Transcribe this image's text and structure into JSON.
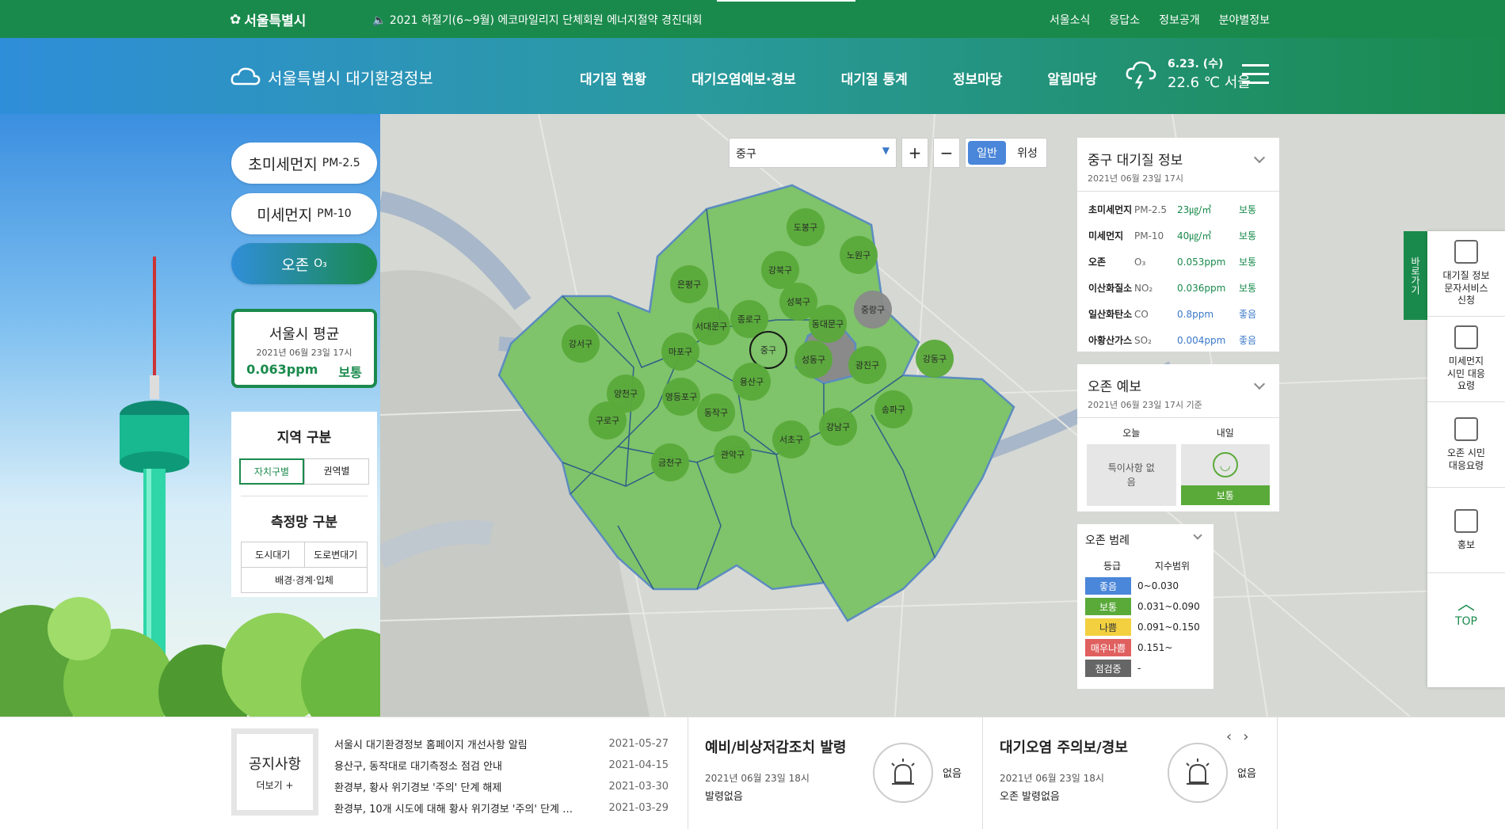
{
  "topbar": {
    "logo": "서울특별시",
    "notice": "2021 하절기(6~9월) 에코마일리지 단체회원 에너지절약 경진대회",
    "links": [
      "서울소식",
      "응답소",
      "정보공개",
      "분야별정보"
    ]
  },
  "header": {
    "site_title": "서울특별시 대기환경정보",
    "menu": [
      "대기질 현황",
      "대기오염예보·경보",
      "대기질 통계",
      "정보마당",
      "알림마당"
    ],
    "weather_date": "6.23. (수)",
    "weather_temp": "22.6 ℃ 서울"
  },
  "pollutant_tabs": [
    {
      "label": "초미세먼지",
      "sub": "PM-2.5"
    },
    {
      "label": "미세먼지",
      "sub": "PM-10"
    },
    {
      "label": "오존",
      "sub": "O₃"
    }
  ],
  "average": {
    "title": "서울시 평균",
    "date": "2021년 06월 23일 17시",
    "value": "0.063ppm",
    "status": "보통"
  },
  "region": {
    "title": "지역 구분",
    "buttons": [
      "자치구별",
      "권역별"
    ],
    "network_title": "측정망 구분",
    "network": [
      "도시대기",
      "도로변대기",
      "배경·경계·입체"
    ]
  },
  "map_tools": {
    "district": "중구",
    "plus": "+",
    "minus": "−",
    "mode_normal": "일반",
    "mode_satellite": "위성"
  },
  "districts": [
    "도봉구",
    "노원구",
    "강북구",
    "은평구",
    "성북구",
    "중랑구",
    "종로구",
    "서대문구",
    "동대문구",
    "강서구",
    "마포구",
    "중구",
    "성동구",
    "광진구",
    "강동구",
    "용산구",
    "양천구",
    "영등포구",
    "동작구",
    "송파구",
    "구로구",
    "강남구",
    "서초구",
    "관악구",
    "금천구"
  ],
  "info_panel": {
    "title": "중구 대기질 정보",
    "date": "2021년 06월 23일 17시",
    "rows": [
      {
        "name": "초미세먼지",
        "code": "PM-2.5",
        "value": "23㎍/㎥",
        "status": "보통"
      },
      {
        "name": "미세먼지",
        "code": "PM-10",
        "value": "40㎍/㎥",
        "status": "보통"
      },
      {
        "name": "오존",
        "code": "O₃",
        "value": "0.053ppm",
        "status": "보통"
      },
      {
        "name": "이산화질소",
        "code": "NO₂",
        "value": "0.036ppm",
        "status": "보통"
      },
      {
        "name": "일산화탄소",
        "code": "CO",
        "value": "0.8ppm",
        "status": "좋음"
      },
      {
        "name": "아황산가스",
        "code": "SO₂",
        "value": "0.004ppm",
        "status": "좋음"
      }
    ]
  },
  "ozone_forecast": {
    "title": "오존 예보",
    "date": "2021년 06월 23일 17시 기준",
    "today_label": "오늘",
    "today_text": "특이사항 없음",
    "tomorrow_label": "내일",
    "tomorrow_status": "보통"
  },
  "legend": {
    "title": "오존 범례",
    "col1": "등급",
    "col2": "지수범위",
    "rows": [
      {
        "grade": "좋음",
        "range": "0~0.030",
        "color": "#4a86d9"
      },
      {
        "grade": "보통",
        "range": "0.031~0.090",
        "color": "#5aaa3a"
      },
      {
        "grade": "나쁨",
        "range": "0.091~0.150",
        "color": "#f2d040"
      },
      {
        "grade": "매우나쁨",
        "range": "0.151~",
        "color": "#e06060"
      },
      {
        "grade": "점검중",
        "range": "-",
        "color": "#666666"
      }
    ]
  },
  "quick_link": "바로가기",
  "sidebar": [
    {
      "label": "대기질 정보 문자서비스 신청"
    },
    {
      "label": "미세먼지 시민 대응요령"
    },
    {
      "label": "오존 시민 대응요령"
    },
    {
      "label": "홍보"
    }
  ],
  "top_label": "TOP",
  "notice_box": {
    "title": "공지사항",
    "more": "더보기 +"
  },
  "notices": [
    {
      "title": "서울시 대기환경정보 홈페이지 개선사항 알림",
      "date": "2021-05-27"
    },
    {
      "title": "용산구, 동작대로 대기측정소 점검 안내",
      "date": "2021-04-15"
    },
    {
      "title": "환경부, 황사 위기경보 '주의' 단계 해제",
      "date": "2021-03-30"
    },
    {
      "title": "환경부, 10개 시도에 대해 황사 위기경보 '주의' 단계 …",
      "date": "2021-03-29"
    }
  ],
  "alert1": {
    "title": "예비/비상저감조치 발령",
    "date": "2021년 06월 23일 18시",
    "status": "발령없음",
    "badge": "없음"
  },
  "alert2": {
    "title": "대기오염 주의보/경보",
    "date": "2021년 06월 23일 18시",
    "status": "오존 발령없음",
    "badge": "없음"
  },
  "colors": {
    "green": "#1a8a4c",
    "blue": "#2f8ed9",
    "district_green": "#7fc36a",
    "district_gray": "#8a8a8a"
  }
}
